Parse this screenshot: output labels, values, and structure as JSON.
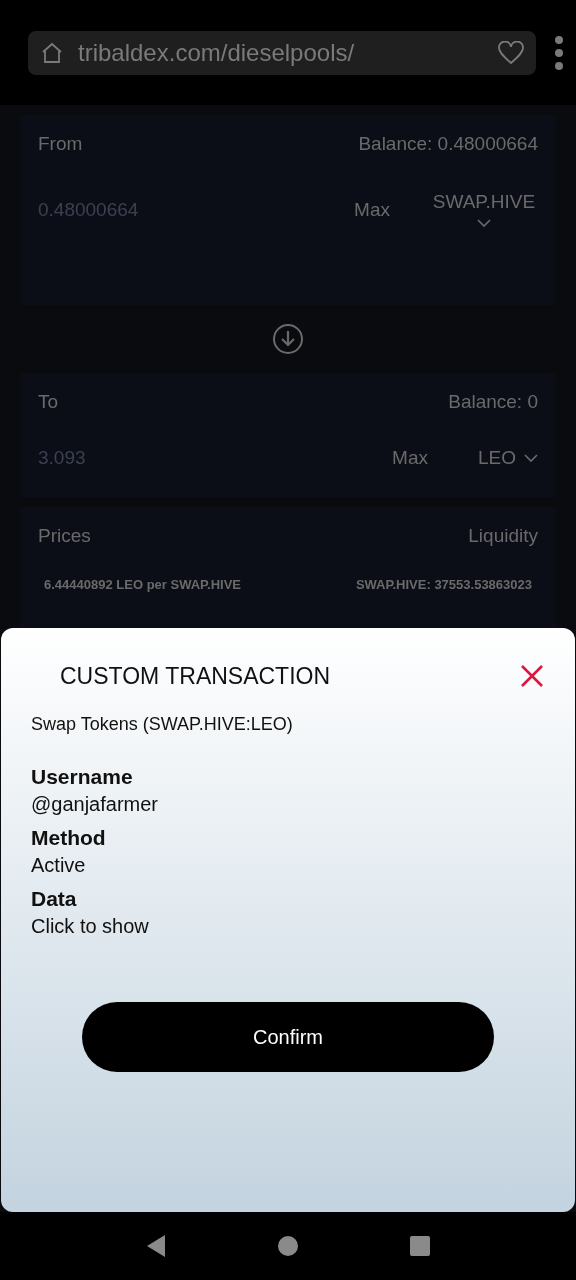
{
  "browser": {
    "url": "tribaldex.com/dieselpools/"
  },
  "swap": {
    "from": {
      "label": "From",
      "balance": "Balance: 0.48000664",
      "amount": "0.48000664",
      "max": "Max",
      "token": "SWAP.HIVE"
    },
    "to": {
      "label": "To",
      "balance": "Balance: 0",
      "amount": "3.093",
      "max": "Max",
      "token": "LEO"
    },
    "info": {
      "prices_label": "Prices",
      "liquidity_label": "Liquidity",
      "price": "6.44440892 LEO per SWAP.HIVE",
      "liquidity": "SWAP.HIVE: 37553.53863023"
    }
  },
  "dialog": {
    "title": "CUSTOM TRANSACTION",
    "subtitle": "Swap Tokens (SWAP.HIVE:LEO)",
    "fields": [
      {
        "label": "Username",
        "value": "@ganjafarmer"
      },
      {
        "label": "Method",
        "value": "Active"
      },
      {
        "label": "Data",
        "value": "Click to show"
      }
    ],
    "confirm": "Confirm"
  }
}
